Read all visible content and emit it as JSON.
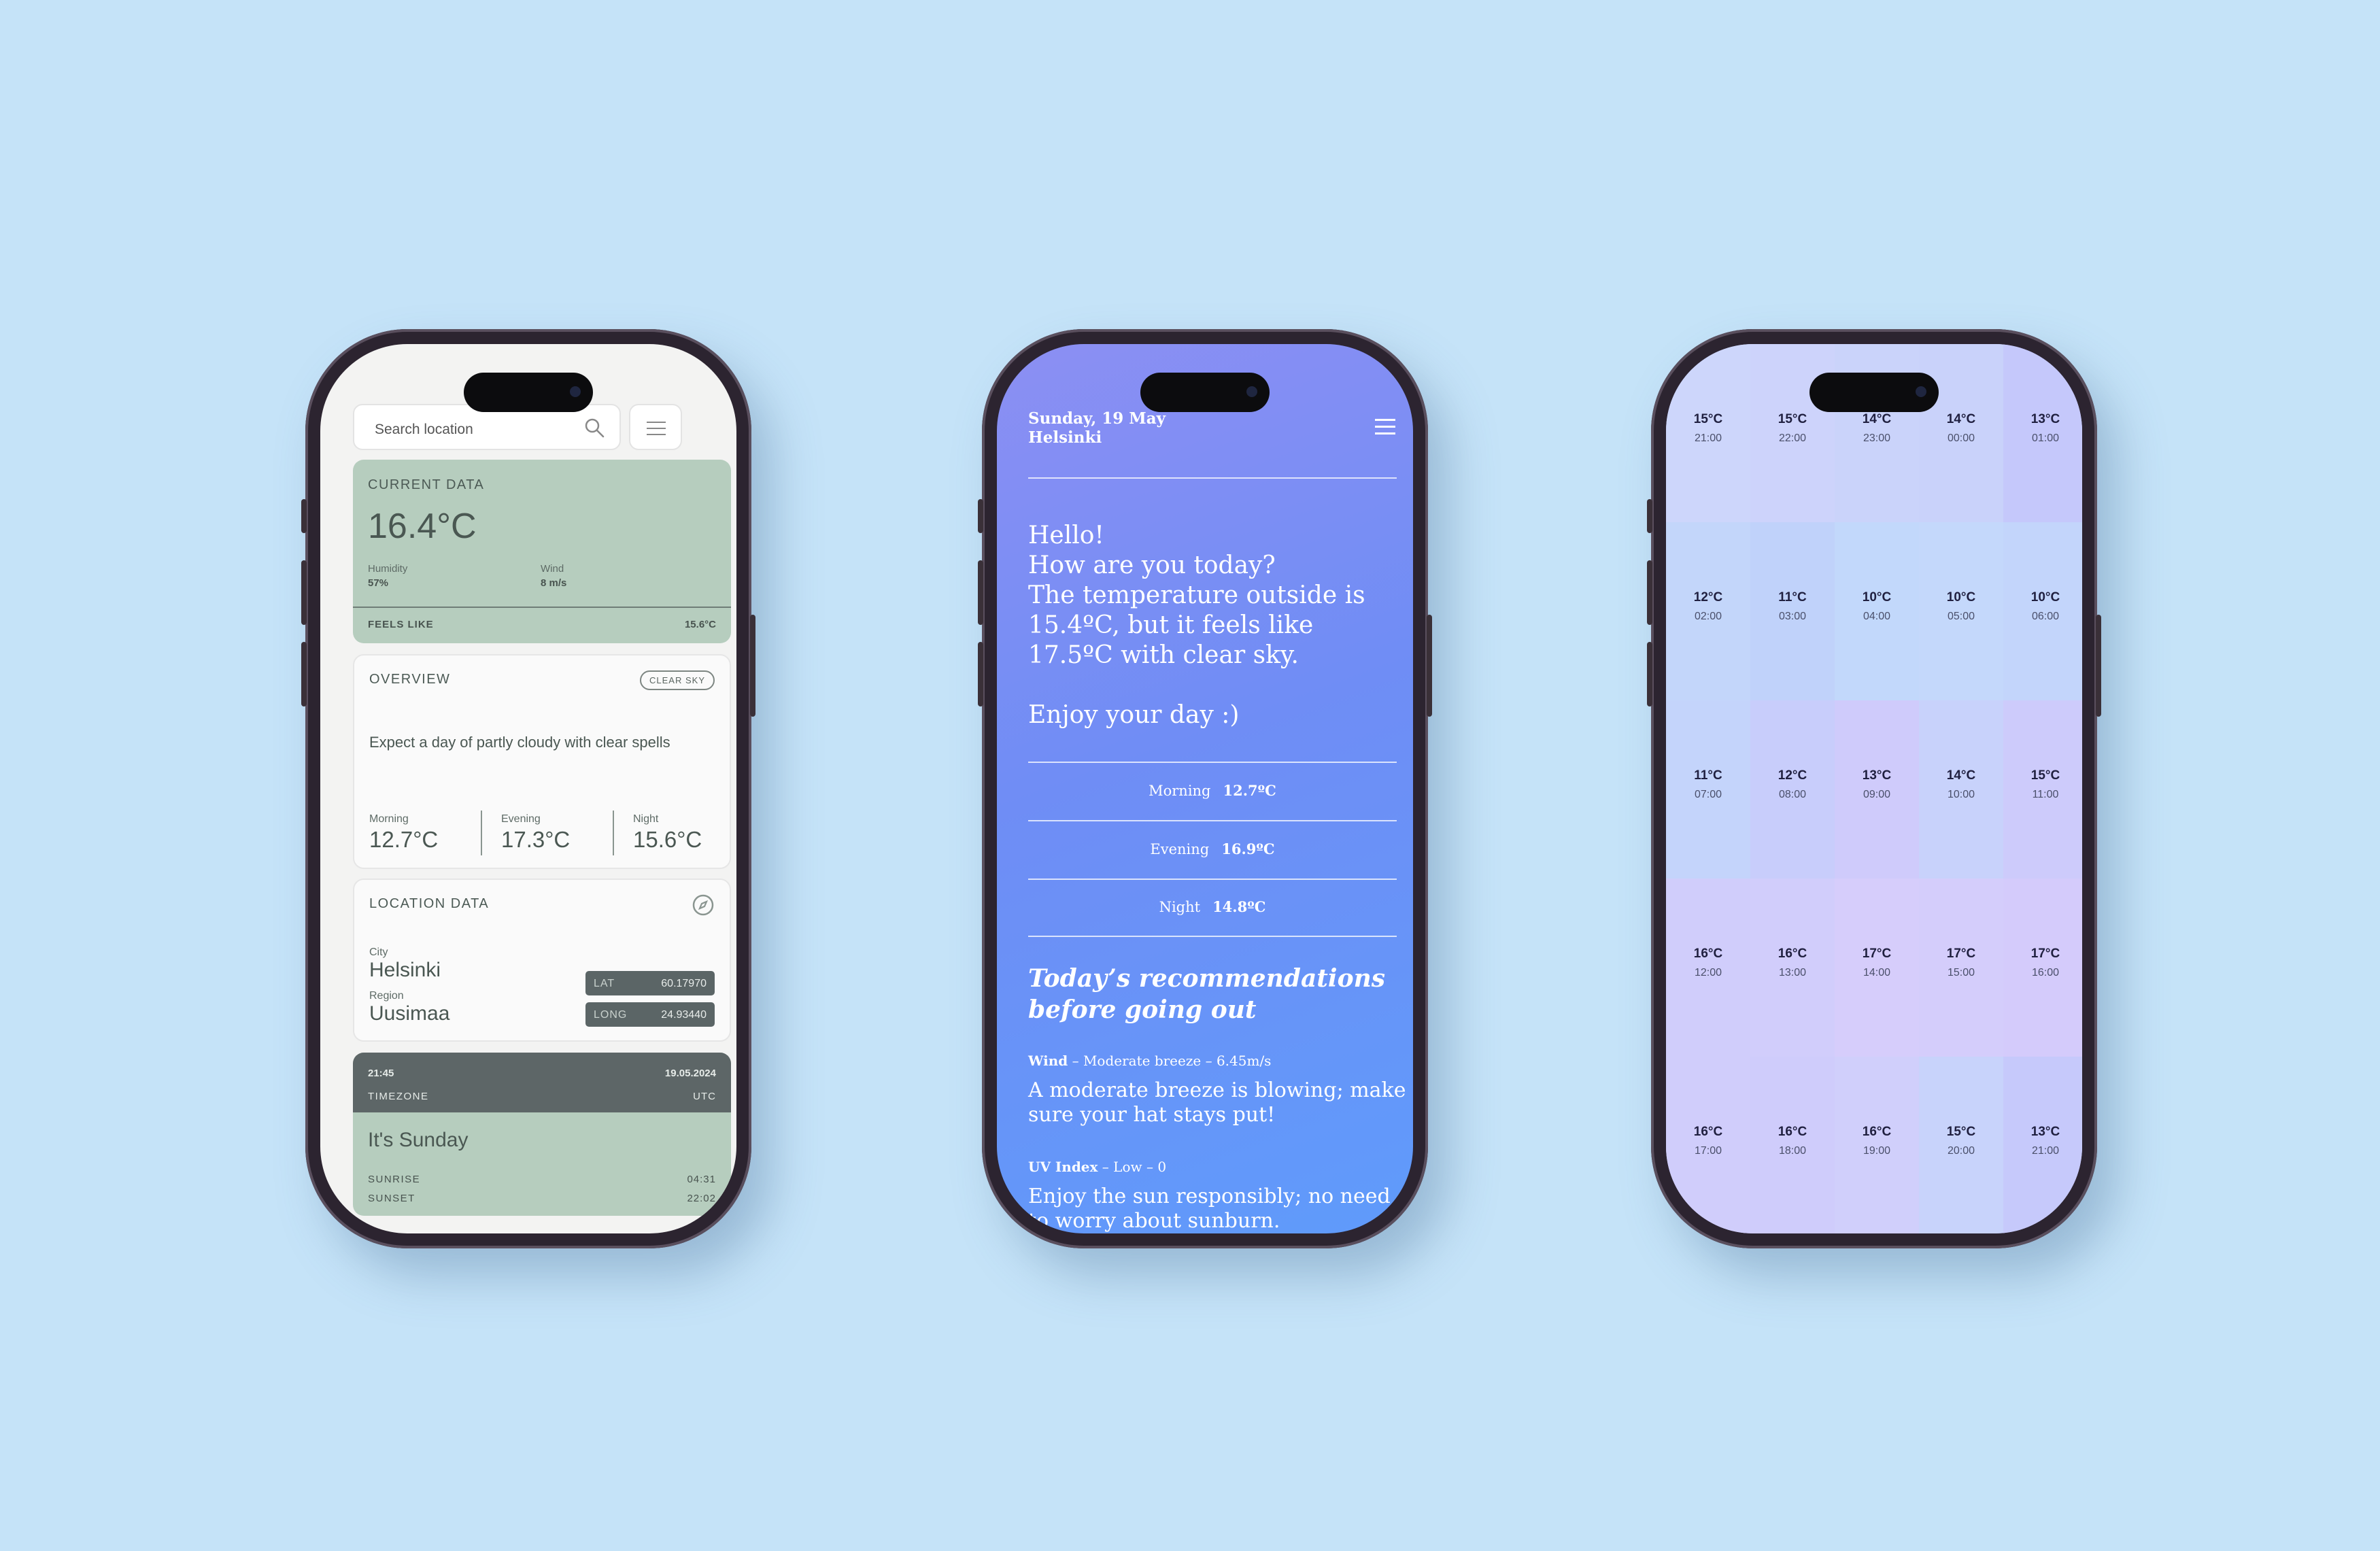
{
  "phone1": {
    "search_placeholder": "Search location",
    "current": {
      "label": "CURRENT DATA",
      "temp": "16.4°C",
      "humidity_label": "Humidity",
      "humidity": "57%",
      "wind_label": "Wind",
      "wind": "8 m/s",
      "feels_label": "FEELS LIKE",
      "feels": "15.6°C"
    },
    "overview": {
      "label": "OVERVIEW",
      "badge": "CLEAR SKY",
      "text": "Expect a day of partly cloudy with clear spells",
      "morning_label": "Morning",
      "morning": "12.7°C",
      "evening_label": "Evening",
      "evening": "17.3°C",
      "night_label": "Night",
      "night": "15.6°C"
    },
    "location": {
      "label": "LOCATION DATA",
      "city_label": "City",
      "city": "Helsinki",
      "region_label": "Region",
      "region": "Uusimaa",
      "lat_label": "LAT",
      "lat": "60.17970",
      "long_label": "LONG",
      "long": "24.93440"
    },
    "time": {
      "clock": "21:45",
      "date": "19.05.2024",
      "timezone_label": "TIMEZONE",
      "timezone": "UTC",
      "day": "It's Sunday",
      "sunrise_label": "SUNRISE",
      "sunrise": "04:31",
      "sunset_label": "SUNSET",
      "sunset": "22:02"
    }
  },
  "phone2": {
    "date": "Sunday, 19 May",
    "city": "Helsinki",
    "greeting": [
      "Hello!",
      "How are you today?",
      "The temperature outside is",
      "15.4ºC, but it feels like",
      "17.5ºC with clear sky.",
      "",
      "Enjoy your day :)"
    ],
    "rows": [
      {
        "label": "Morning",
        "value": "12.7ºC"
      },
      {
        "label": "Evening",
        "value": "16.9ºC"
      },
      {
        "label": "Night",
        "value": "14.8ºC"
      }
    ],
    "rec_title": "Today’s recommendations before going out",
    "wind_head_bold": "Wind",
    "wind_head_rest": " – Moderate breeze – 6.45m/s",
    "wind_body": "A moderate breeze is blowing; make sure your hat stays put!",
    "uv_head_bold": "UV Index",
    "uv_head_rest": " – Low – 0",
    "uv_body": "Enjoy the sun responsibly; no need to worry about sunburn."
  },
  "phone3": {
    "hours": [
      {
        "temp": "15°C",
        "time": "21:00"
      },
      {
        "temp": "15°C",
        "time": "22:00"
      },
      {
        "temp": "14°C",
        "time": "23:00"
      },
      {
        "temp": "14°C",
        "time": "00:00"
      },
      {
        "temp": "13°C",
        "time": "01:00"
      },
      {
        "temp": "12°C",
        "time": "02:00"
      },
      {
        "temp": "11°C",
        "time": "03:00"
      },
      {
        "temp": "10°C",
        "time": "04:00"
      },
      {
        "temp": "10°C",
        "time": "05:00"
      },
      {
        "temp": "10°C",
        "time": "06:00"
      },
      {
        "temp": "11°C",
        "time": "07:00"
      },
      {
        "temp": "12°C",
        "time": "08:00"
      },
      {
        "temp": "13°C",
        "time": "09:00"
      },
      {
        "temp": "14°C",
        "time": "10:00"
      },
      {
        "temp": "15°C",
        "time": "11:00"
      },
      {
        "temp": "16°C",
        "time": "12:00"
      },
      {
        "temp": "16°C",
        "time": "13:00"
      },
      {
        "temp": "17°C",
        "time": "14:00"
      },
      {
        "temp": "17°C",
        "time": "15:00"
      },
      {
        "temp": "17°C",
        "time": "16:00"
      },
      {
        "temp": "16°C",
        "time": "17:00"
      },
      {
        "temp": "16°C",
        "time": "18:00"
      },
      {
        "temp": "16°C",
        "time": "19:00"
      },
      {
        "temp": "15°C",
        "time": "20:00"
      },
      {
        "temp": "13°C",
        "time": "21:00"
      }
    ]
  }
}
